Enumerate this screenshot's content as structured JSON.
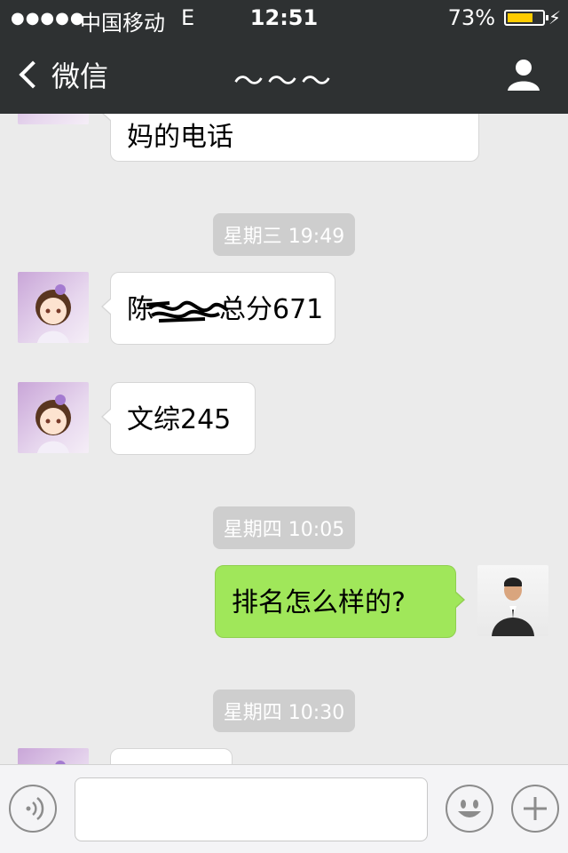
{
  "status_bar": {
    "signal": "●●●●●",
    "carrier": "中国移动",
    "network": "E",
    "time": "12:51",
    "battery_percent": "73%",
    "battery_level": 0.73,
    "battery_color": "#ffcc00"
  },
  "nav": {
    "back_label": "微信",
    "title": "～～～"
  },
  "messages": {
    "m0_text": "妈的电话",
    "ts1": "星期三 19:49",
    "m1_prefix": "陈",
    "m1_text": "总分671",
    "m2_text": "文综245",
    "ts2": "星期四 10:05",
    "m3_text": "排名怎么样的?",
    "ts3": "星期四 10:30",
    "m4_text": ""
  },
  "input_bar": {
    "voice_icon": "voice-icon",
    "emoji_icon": "emoji-icon",
    "plus_icon": "plus-icon"
  },
  "colors": {
    "header": "#2e3132",
    "background": "#ebebeb",
    "sent_bubble": "#a0e75a",
    "received_bubble": "#ffffff",
    "timestamp_bg": "#cecece"
  }
}
